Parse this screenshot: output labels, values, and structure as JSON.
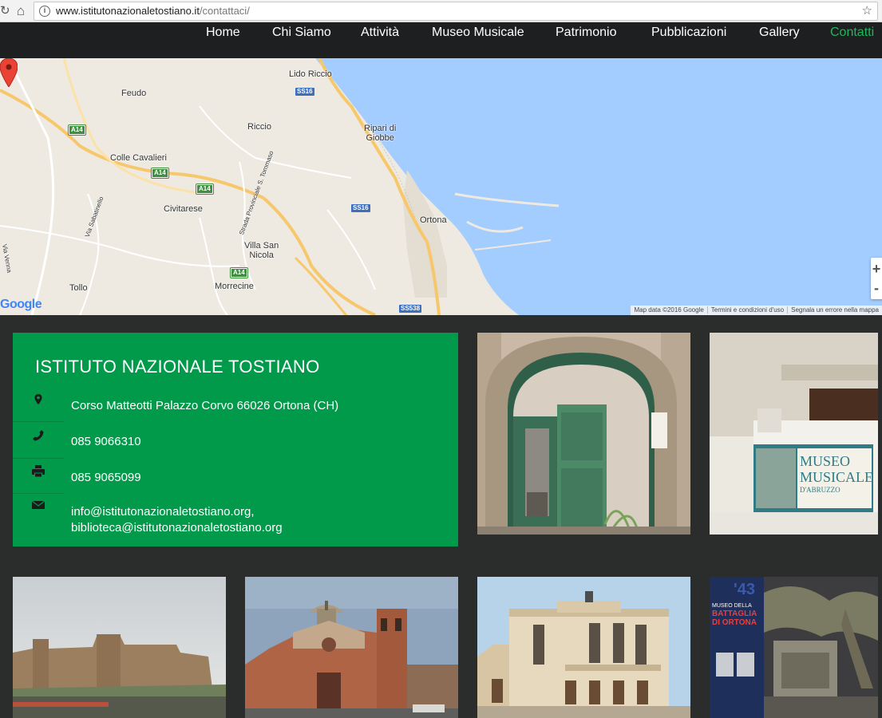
{
  "browser": {
    "url_host": "www.istitutonazionaletostiano.it",
    "url_path": "/contattaci/"
  },
  "nav": {
    "items": [
      "Home",
      "Chi Siamo",
      "Attività",
      "Museo Musicale",
      "Patrimonio",
      "Pubblicazioni",
      "Gallery",
      "Contatti"
    ],
    "active": "Contatti",
    "active_color": "#1fb85a"
  },
  "map": {
    "labels": {
      "lido_riccio": "Lido Riccio",
      "feudo": "Feudo",
      "riccio": "Riccio",
      "ripari": "Ripari di\nGiobbe",
      "colle_cavalieri": "Colle Cavalieri",
      "civitarese": "Civitarese",
      "ortona": "Ortona",
      "villa_san_nicola": "Villa San\nNicola",
      "tollo": "Tollo",
      "morrecine": "Morrecine",
      "via_venna": "Via Venna",
      "via_sabatinello": "Via Sabatinello",
      "strada_provinciale": "Strada Provinciale S. Tommaso"
    },
    "shields": {
      "ss16_a": "SS16",
      "ss16_b": "SS16",
      "a14_a": "A14",
      "a14_b": "A14",
      "a14_c": "A14",
      "a14_d": "A14",
      "ss538": "SS538"
    },
    "google": "Google",
    "credits": [
      "Map data ©2016 Google",
      "Termini e condizioni d'uso",
      "Segnala un errore nella mappa"
    ],
    "zoom_in": "+",
    "zoom_out": "-"
  },
  "contact": {
    "title": "ISTITUTO NAZIONALE TOSTIANO",
    "address": "Corso Matteotti Palazzo Corvo 66026 Ortona (CH)",
    "phone": "085 9066310",
    "fax": "085 9065099",
    "email_1": "info@istitutonazionaletostiano.org,",
    "email_2": "biblioteca@istitutonazionaletostiano.org",
    "card_color": "#019a4a"
  },
  "photos": {
    "museo_sign": [
      "MUSEO",
      "MUSICALE",
      "D'ABRUZZO"
    ],
    "battaglia_sign": [
      "'43",
      "MUSEO DELLA",
      "BATTAGLIA",
      "DI ORTONA"
    ]
  }
}
